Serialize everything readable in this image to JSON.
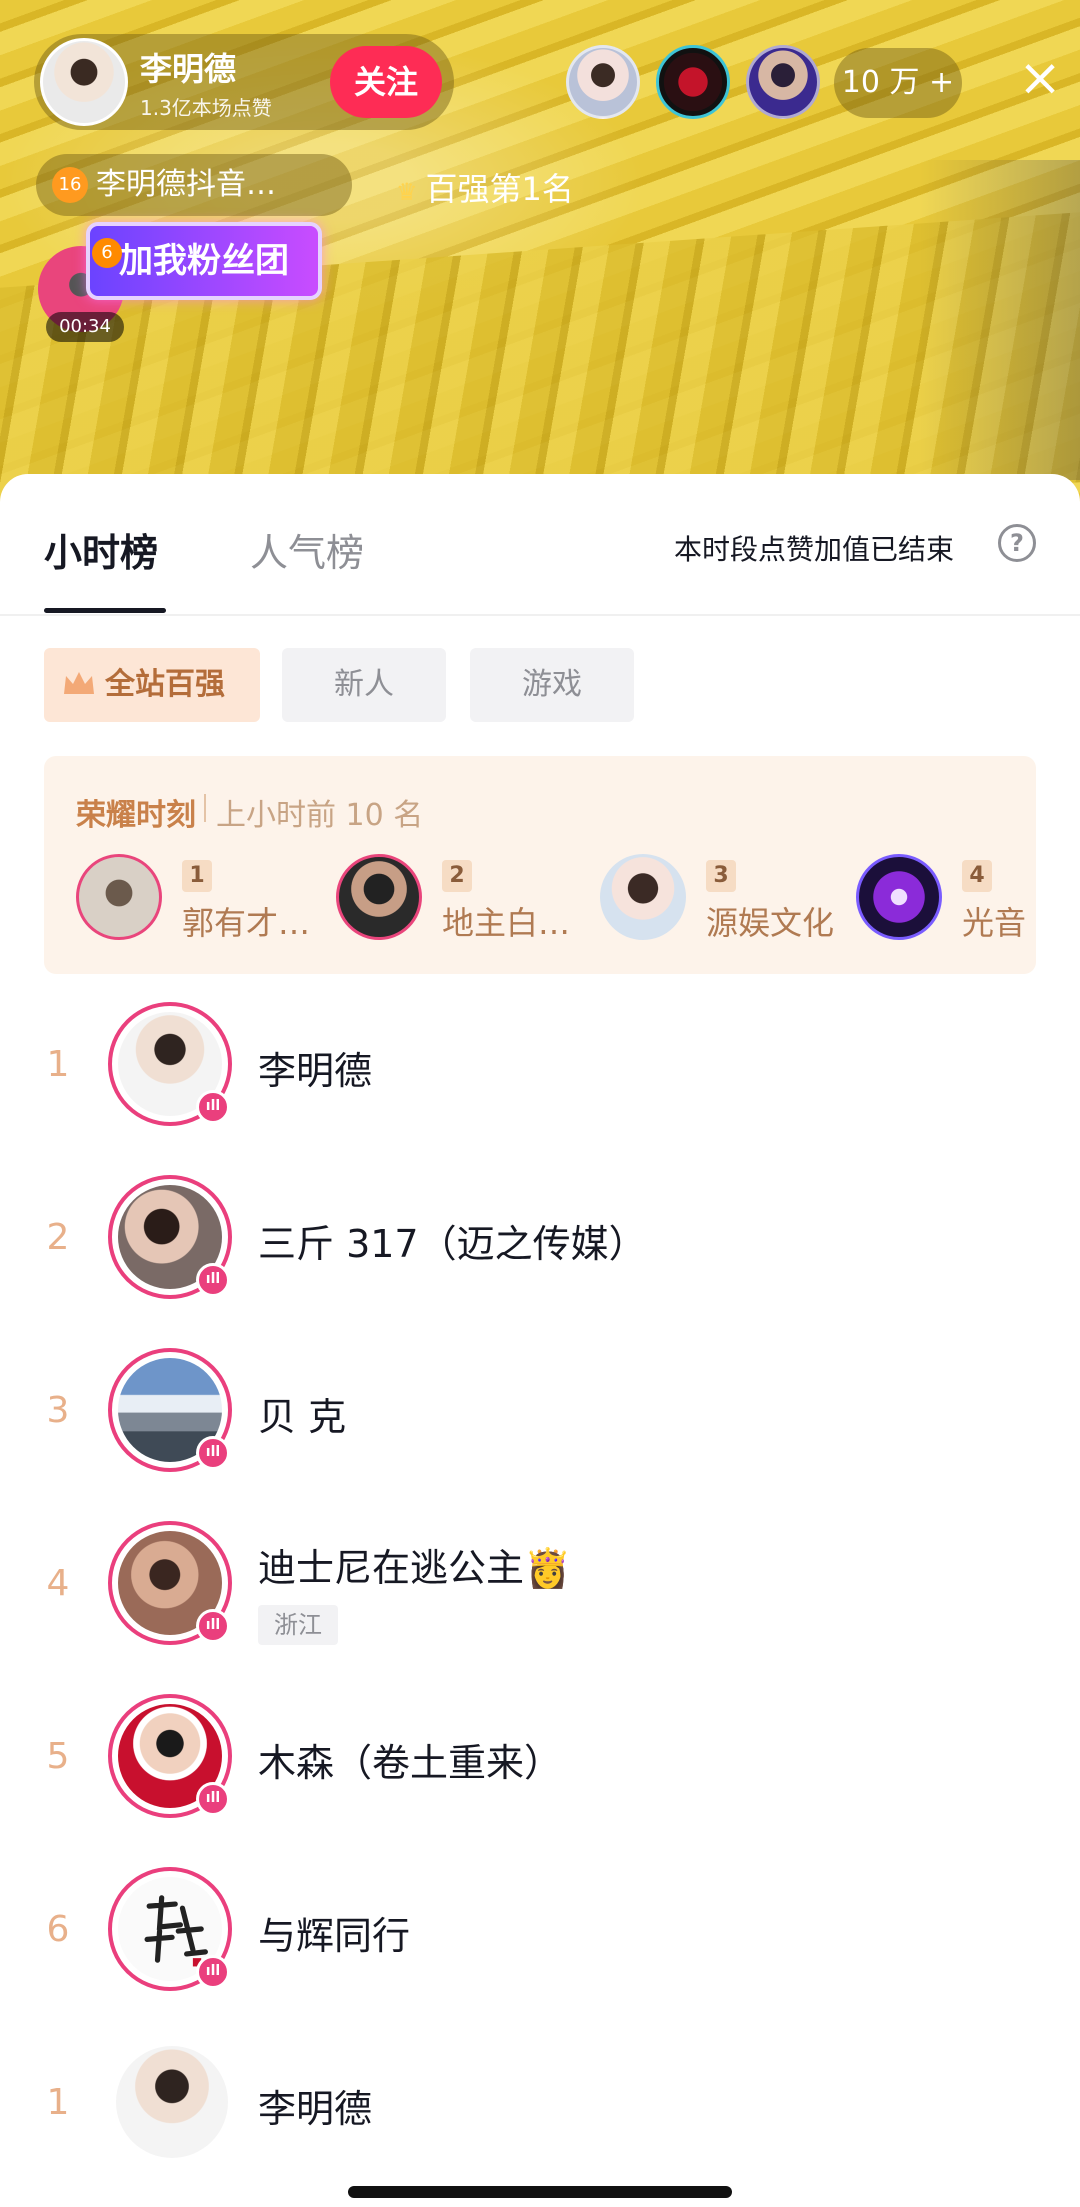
{
  "stream": {
    "host_name": "李明德",
    "host_likes": "1.3亿本场点赞",
    "follow_label": "关注",
    "viewer_count": "10 万 +",
    "close_icon": "×",
    "fanclub_text": "李明德抖音…",
    "fanclub_level": "16",
    "rank_text": "百强第1名",
    "join_banner": "加我粉丝团",
    "join_badge": "6",
    "timer": "00:34"
  },
  "sheet": {
    "tabs": [
      {
        "label": "小时榜",
        "active": true
      },
      {
        "label": "人气榜",
        "active": false
      }
    ],
    "hint": "本时段点赞加值已结束",
    "help_icon": "?",
    "chips": [
      "全站百强",
      "新人",
      "游戏"
    ],
    "glory": {
      "title": "荣耀时刻",
      "subtitle": "上小时前 10 名",
      "items": [
        {
          "rank": "1",
          "name": "郭有才…"
        },
        {
          "rank": "2",
          "name": "地主白…"
        },
        {
          "rank": "3",
          "name": "源娱文化"
        },
        {
          "rank": "4",
          "name": "光音"
        }
      ]
    },
    "ranking": [
      {
        "rank": "1",
        "name": "李明德",
        "tag": ""
      },
      {
        "rank": "2",
        "name": "三斤 317（迈之传媒）",
        "tag": ""
      },
      {
        "rank": "3",
        "name": "贝 克",
        "tag": ""
      },
      {
        "rank": "4",
        "name": "迪士尼在逃公主👸",
        "tag": "浙江"
      },
      {
        "rank": "5",
        "name": "木森（卷土重来）",
        "tag": ""
      },
      {
        "rank": "6",
        "name": "与辉同行",
        "tag": ""
      }
    ],
    "self_row": {
      "rank": "1",
      "name": "李明德"
    },
    "live_icon": "ıll"
  },
  "colors": {
    "accent": "#fe2c55",
    "ring": "#ea3f7d",
    "rank_number": "#e8b08a",
    "chip_active_bg": "#fde6d6"
  }
}
